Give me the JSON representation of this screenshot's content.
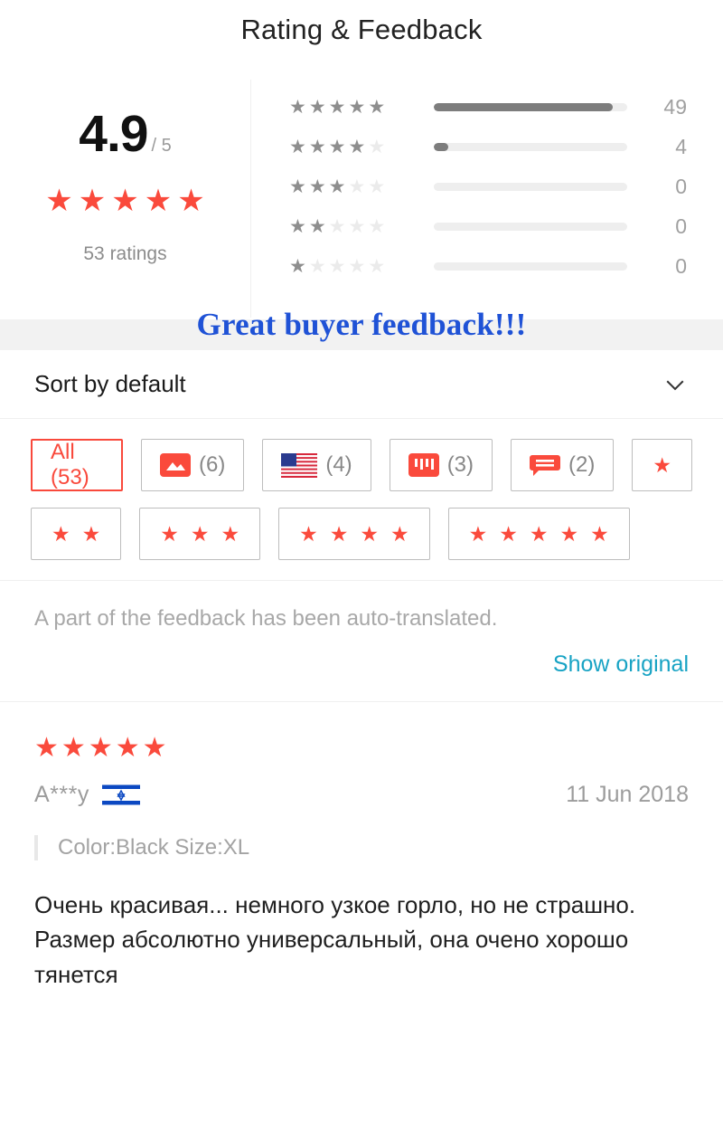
{
  "header": {
    "title": "Rating & Feedback"
  },
  "summary": {
    "score": "4.9",
    "denominator": "/ 5",
    "stars_filled": 5,
    "ratings_text": "53 ratings"
  },
  "histogram": {
    "rows": [
      {
        "stars": 5,
        "count": "49",
        "percent": 92.5
      },
      {
        "stars": 4,
        "count": "4",
        "percent": 7.5
      },
      {
        "stars": 3,
        "count": "0",
        "percent": 0
      },
      {
        "stars": 2,
        "count": "0",
        "percent": 0
      },
      {
        "stars": 1,
        "count": "0",
        "percent": 0
      }
    ]
  },
  "annotation": {
    "text": "Great buyer feedback!!!",
    "color": "#1f52d6"
  },
  "sort": {
    "label": "Sort by default"
  },
  "filters": {
    "row1": [
      {
        "name": "all",
        "label": "All (53)",
        "icon": "none",
        "selected": true
      },
      {
        "name": "with-photos",
        "label": "(6)",
        "icon": "image-icon",
        "selected": false
      },
      {
        "name": "country-us",
        "label": "(4)",
        "icon": "flag-us-icon",
        "selected": false
      },
      {
        "name": "with-videos",
        "label": "(3)",
        "icon": "video-icon",
        "selected": false
      },
      {
        "name": "with-comments",
        "label": "(2)",
        "icon": "comment-icon",
        "selected": false
      },
      {
        "name": "one-star",
        "label": "",
        "icon": "star-icon",
        "stars": 1,
        "selected": false
      }
    ],
    "row2": [
      {
        "name": "two-star",
        "stars": 2,
        "selected": false
      },
      {
        "name": "three-star",
        "stars": 3,
        "selected": false
      },
      {
        "name": "four-star",
        "stars": 4,
        "selected": false
      },
      {
        "name": "five-star",
        "stars": 5,
        "selected": false
      }
    ]
  },
  "translate": {
    "notice": "A part of the feedback has been auto-translated.",
    "show_original": "Show original"
  },
  "review": {
    "stars": 5,
    "user": "A***y",
    "country_flag": "flag-israel-icon",
    "date": "11 Jun 2018",
    "sku": "Color:Black Size:XL",
    "body": "Очень красивая... немного узкое горло, но не страшно. Размер абсолютно универсальный, она очено хорошо тянется"
  },
  "colors": {
    "accent_red": "#fa4a3c",
    "link_blue": "#18a3c4",
    "annotation_blue": "#1f52d6",
    "bar_fill": "#7d7d7d",
    "bar_track": "#eeeeee"
  }
}
